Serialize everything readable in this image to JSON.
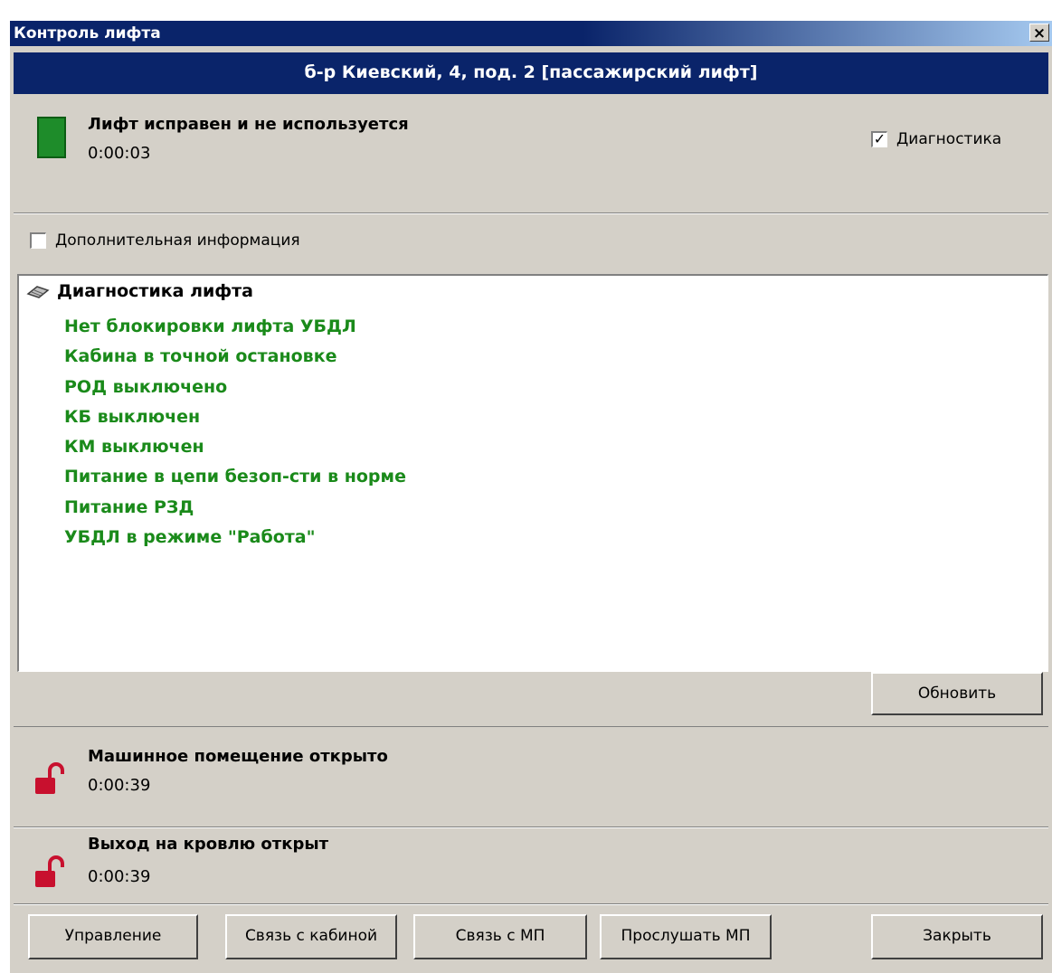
{
  "window": {
    "title": "Контроль лифта",
    "close_glyph": "×",
    "address": "б-р Киевский, 4, под. 2 [пассажирский лифт]"
  },
  "status": {
    "title": "Лифт исправен и не используется",
    "time": "0:00:03",
    "indicator_color": "#1e8c2a",
    "diagnostics_checkbox": {
      "label": "Диагностика",
      "checked": true,
      "glyph": "✓"
    }
  },
  "extra_info_checkbox": {
    "label": "Дополнительная информация",
    "checked": false
  },
  "diagnostics": {
    "heading": "Диагностика лифта",
    "items": [
      "Нет блокировки лифта УБДЛ",
      "Кабина в точной остановке",
      "РОД выключено",
      "КБ выключен",
      "КМ выключен",
      "Питание в цепи безоп-сти в норме",
      "Питание РЗД",
      "УБДЛ в режиме \"Работа\""
    ],
    "item_color": "#1a8a1a"
  },
  "refresh_button": "Обновить",
  "machine_room": {
    "title": "Машинное помещение открыто",
    "time": "0:00:39",
    "lock_color": "#c8102e"
  },
  "roof_exit": {
    "title": "Выход на кровлю открыт",
    "time": "0:00:39",
    "lock_color": "#c8102e"
  },
  "buttons": {
    "control": "Управление",
    "cabin_call": "Связь с кабиной",
    "mp_call": "Связь с МП",
    "listen_mp": "Прослушать МП",
    "close": "Закрыть"
  }
}
